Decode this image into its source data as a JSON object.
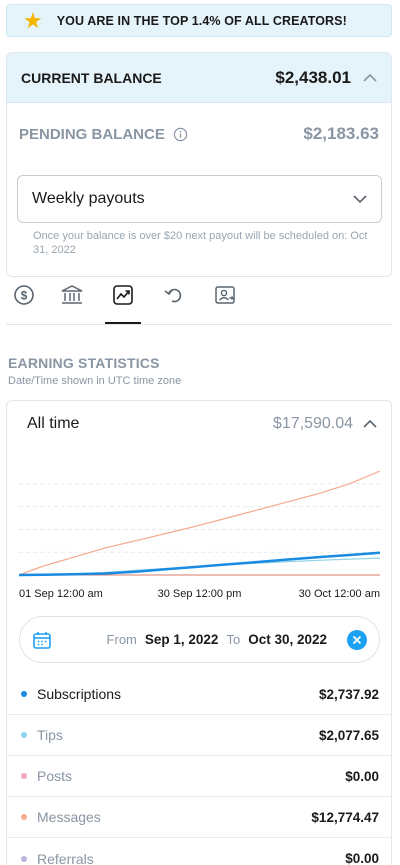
{
  "banner": {
    "text": "YOU ARE IN THE TOP 1.4% OF ALL CREATORS!",
    "star_color": "#f5b400"
  },
  "balance": {
    "current_label": "CURRENT BALANCE",
    "current_amount": "$2,438.01",
    "pending_label": "PENDING BALANCE",
    "pending_amount": "$2,183.63",
    "payout_select": "Weekly payouts",
    "payout_note": "Once your balance is over $20 next payout will be scheduled on: Oct 31, 2022"
  },
  "tabs": [
    {
      "icon": "dollar-circle-icon"
    },
    {
      "icon": "bank-icon"
    },
    {
      "icon": "chart-icon",
      "active": true
    },
    {
      "icon": "refund-icon"
    },
    {
      "icon": "user-document-icon"
    }
  ],
  "stats": {
    "title": "EARNING STATISTICS",
    "subtitle": "Date/Time shown in UTC time zone",
    "period_label": "All time",
    "period_total": "$17,590.04",
    "date_range": {
      "from_label": "From",
      "from": "Sep 1, 2022",
      "to_label": "To",
      "to": "Oct 30, 2022"
    },
    "legend": [
      {
        "name": "Subscriptions",
        "value": "$2,737.92",
        "color": "#1a8be0"
      },
      {
        "name": "Tips",
        "value": "$2,077.65",
        "color": "#8fd3e8"
      },
      {
        "name": "Posts",
        "value": "$0.00",
        "color": "#f2a7bf"
      },
      {
        "name": "Messages",
        "value": "$12,774.47",
        "color": "#f5a98f"
      },
      {
        "name": "Referrals",
        "value": "$0.00",
        "color": "#b9b4dd"
      }
    ]
  },
  "chart_data": {
    "type": "line",
    "x_tick_labels": [
      "01 Sep 12:00 am",
      "30 Sep 12:00 pm",
      "30 Oct 12:00 am"
    ],
    "x": [
      "2022-09-01",
      "2022-09-05",
      "2022-09-10",
      "2022-09-15",
      "2022-09-20",
      "2022-09-25",
      "2022-09-30",
      "2022-10-05",
      "2022-10-10",
      "2022-10-15",
      "2022-10-20",
      "2022-10-25",
      "2022-10-30"
    ],
    "series": [
      {
        "name": "Messages",
        "color": "#f5a98f",
        "width": 1.2,
        "values": [
          0,
          1100,
          2200,
          3300,
          4200,
          5100,
          6000,
          7000,
          8000,
          9000,
          10000,
          11200,
          12774
        ]
      },
      {
        "name": "Subscriptions",
        "color": "#1a8be0",
        "width": 2.5,
        "values": [
          0,
          40,
          90,
          180,
          400,
          700,
          1000,
          1300,
          1600,
          1900,
          2200,
          2450,
          2738
        ]
      },
      {
        "name": "Tips",
        "color": "#8fd3e8",
        "width": 1.2,
        "values": [
          0,
          60,
          150,
          300,
          560,
          800,
          1000,
          1250,
          1450,
          1650,
          1800,
          1950,
          2078
        ]
      },
      {
        "name": "Posts",
        "color": "#f2a7bf",
        "width": 1,
        "values": [
          0,
          0,
          0,
          0,
          0,
          0,
          0,
          0,
          0,
          0,
          0,
          0,
          0
        ]
      },
      {
        "name": "Referrals",
        "color": "#d77b6a",
        "width": 1,
        "values": [
          0,
          0,
          0,
          0,
          0,
          0,
          0,
          0,
          0,
          0,
          0,
          0,
          0
        ]
      }
    ],
    "ylim": [
      0,
      14000
    ],
    "grid": true,
    "grid_style": "dashed"
  }
}
